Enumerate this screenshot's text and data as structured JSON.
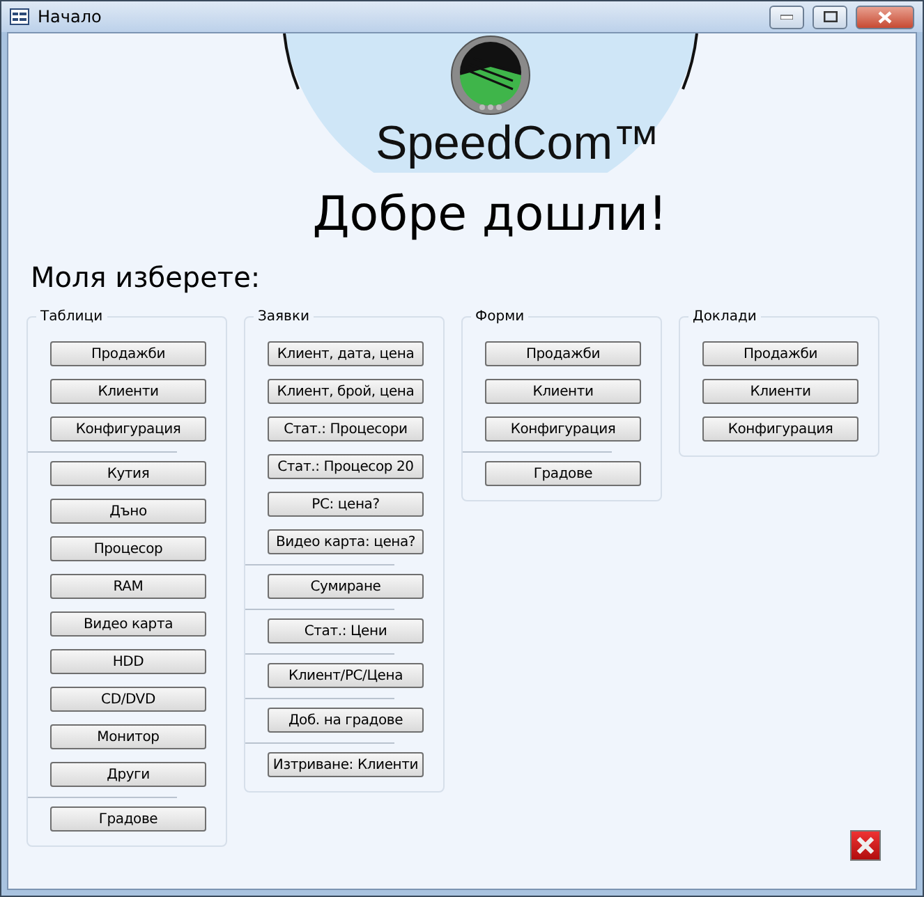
{
  "window": {
    "title": "Начало"
  },
  "logo": {
    "text": "SpeedCom™"
  },
  "heading": "Добре дошли!",
  "prompt": "Моля изберете:",
  "groups": [
    {
      "title": "Таблици",
      "sections": [
        [
          "Продажби",
          "Клиенти",
          "Конфигурация"
        ],
        [
          "Кутия",
          "Дъно",
          "Процесор",
          "RAM",
          "Видео карта",
          "HDD",
          "CD/DVD",
          "Монитор",
          "Други"
        ],
        [
          "Градове"
        ]
      ]
    },
    {
      "title": "Заявки",
      "sections": [
        [
          "Клиент, дата, цена",
          "Клиент, брой, цена",
          "Стат.: Процесори",
          "Стат.: Процесор 20",
          "PC: цена?",
          "Видео карта: цена?"
        ],
        [
          "Сумиране"
        ],
        [
          "Стат.: Цени"
        ],
        [
          "Клиент/PC/Цена"
        ],
        [
          "Доб. на градове"
        ],
        [
          "Изтриване: Клиенти"
        ]
      ]
    },
    {
      "title": "Форми",
      "sections": [
        [
          "Продажби",
          "Клиенти",
          "Конфигурация"
        ],
        [
          "Градове"
        ]
      ]
    },
    {
      "title": "Доклади",
      "sections": [
        [
          "Продажби",
          "Клиенти",
          "Конфигурация"
        ]
      ]
    }
  ]
}
